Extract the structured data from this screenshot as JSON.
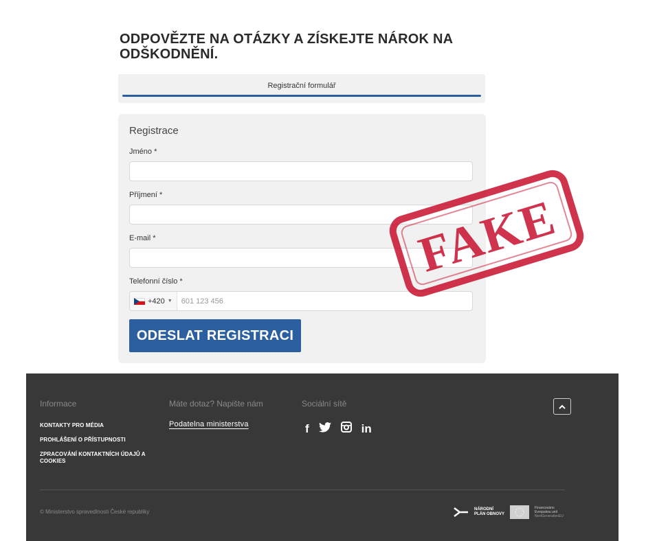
{
  "headline": "ODPOVĚZTE NA OTÁZKY A ZÍSKEJTE NÁROK NA ODŠKODNĚNÍ.",
  "stepper": {
    "label": "Registrační formulář"
  },
  "form": {
    "title": "Registrace",
    "first_name_label": "Jméno *",
    "last_name_label": "Příjmení *",
    "email_label": "E-mail *",
    "phone_label": "Telefonní číslo *",
    "phone_country_code": "+420",
    "phone_placeholder": "601 123 456",
    "submit_label": "ODESLAT REGISTRACI"
  },
  "stamp": {
    "text": "FAKE",
    "color": "#c8102e"
  },
  "footer": {
    "info_heading": "Informace",
    "info_links": [
      "KONTAKTY PRO MÉDIA",
      "PROHLÁŠENÍ O PŘÍSTUPNOSTI",
      "ZPRACOVÁNÍ KONTAKTNÍCH ÚDAJŮ A COOKIES"
    ],
    "contact_heading": "Máte dotaz? Napište nám",
    "contact_link": "Podatelna ministerstva",
    "social_heading": "Sociální sítě",
    "social_icons": [
      "facebook-icon",
      "twitter-icon",
      "instagram-icon",
      "linkedin-icon"
    ],
    "copyright": "© Ministerstvo spravedlnosti České republiky",
    "npo_line1": "NÁRODNÍ",
    "npo_line2": "PLÁN OBNOVY",
    "eu_line1": "Financováno",
    "eu_line2": "Evropskou unií",
    "eu_line3": "NextGenerationEU"
  },
  "colors": {
    "accent": "#2c5fa0",
    "footer_bg": "#383838",
    "card_bg": "#f1f1f1"
  }
}
